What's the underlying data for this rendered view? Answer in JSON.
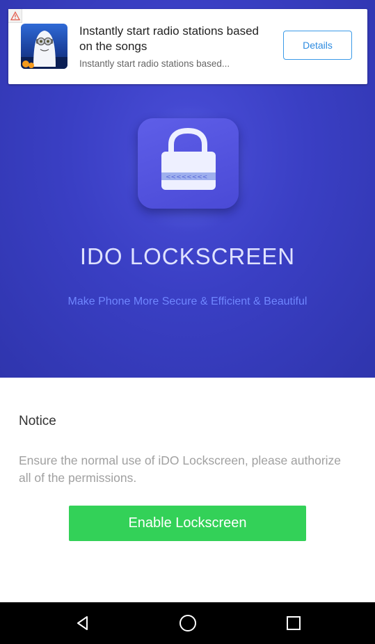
{
  "ad": {
    "title": "Instantly start radio stations based on the songs",
    "subtitle": "Instantly start radio stations based...",
    "button_label": "Details",
    "badge_icon": "ad-warning-icon"
  },
  "hero": {
    "app_title": "IDO LOCKSCREEN",
    "tagline": "Make Phone More Secure & Efficient & Beautiful",
    "icon": "padlock-icon"
  },
  "notice": {
    "title": "Notice",
    "body": "Ensure the normal use of iDO Lockscreen, please authorize all of the permissions.",
    "button_label": "Enable Lockscreen"
  },
  "navbar": {
    "icons": [
      "back-icon",
      "home-icon",
      "recents-icon"
    ]
  },
  "colors": {
    "hero_bg": "#3a3fc4",
    "accent_green": "#33d158",
    "tagline": "#6f86ff",
    "details_border": "#3a9ae8"
  }
}
